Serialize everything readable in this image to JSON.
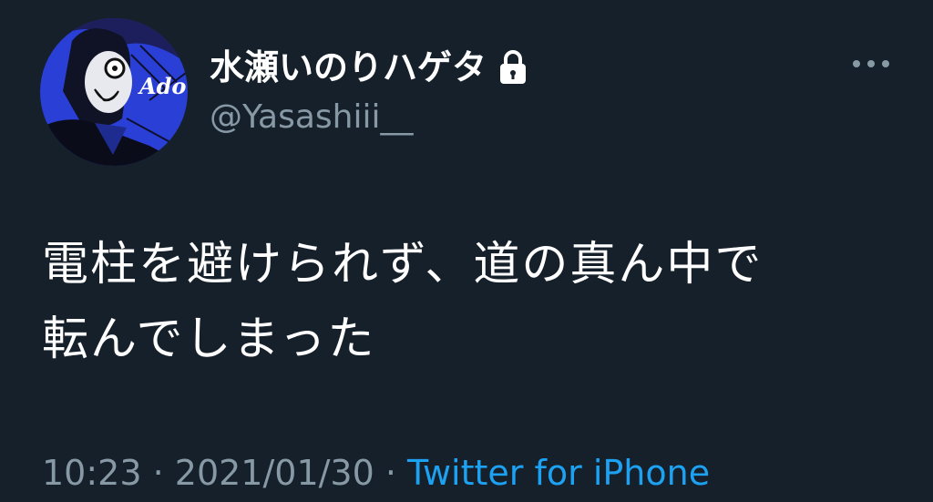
{
  "author": {
    "display_name": "水瀬いのりハゲタ",
    "handle": "@Yasashiii__",
    "avatar_label": "Ado",
    "protected": true
  },
  "tweet": {
    "line1": "電柱を避けられず、道の真ん中で",
    "line2": "転んでしまった"
  },
  "meta": {
    "time": "10:23",
    "separator1": " · ",
    "date": "2021/01/30",
    "separator2": " · ",
    "source": "Twitter for iPhone"
  },
  "icons": {
    "lock": "lock-icon",
    "more": "more-icon"
  },
  "colors": {
    "background": "#15202b",
    "text_primary": "#ffffff",
    "text_secondary": "#8899a6",
    "link": "#1da1f2"
  }
}
